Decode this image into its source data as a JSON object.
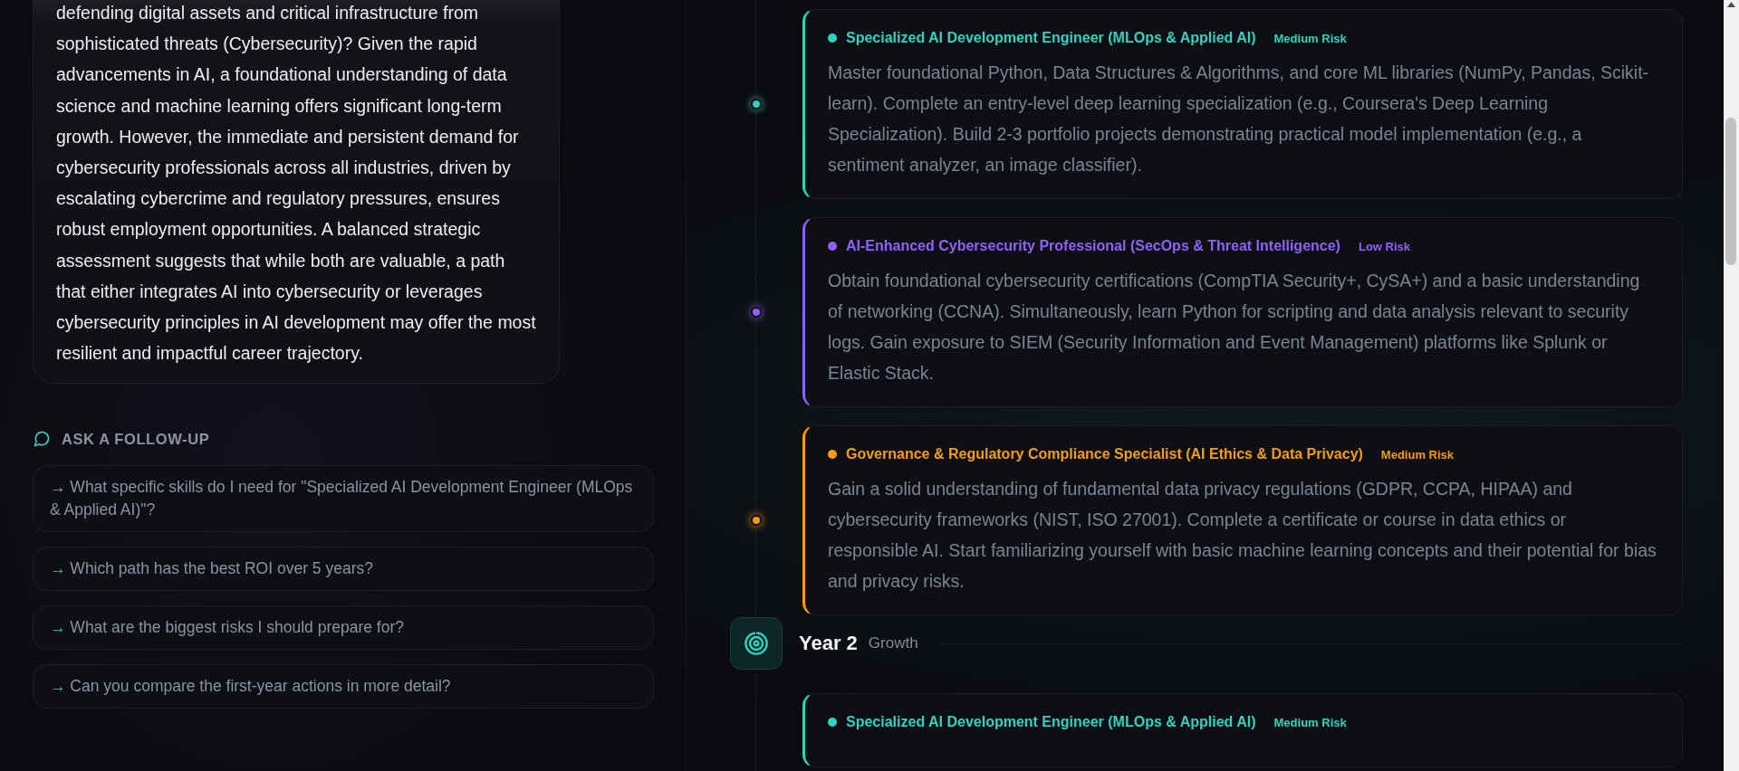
{
  "summary": {
    "text": "defending digital assets and critical infrastructure from sophisticated threats (Cybersecurity)? Given the rapid advancements in AI, a foundational understanding of data science and machine learning offers significant long-term growth. However, the immediate and persistent demand for cybersecurity professionals across all industries, driven by escalating cybercrime and regulatory pressures, ensures robust employment opportunities. A balanced strategic assessment suggests that while both are valuable, a path that either integrates AI into cybersecurity or leverages cybersecurity principles in AI development may offer the most resilient and impactful career trajectory."
  },
  "follow_up": {
    "heading": "ASK A FOLLOW-UP",
    "suggestions": [
      {
        "arrow": "→",
        "text": "What specific skills do I need for \"Specialized AI Development Engineer (MLOps & Applied AI)\"?"
      },
      {
        "arrow": "→",
        "text": "Which path has the best ROI over 5 years?"
      },
      {
        "arrow": "→",
        "text": "What are the biggest risks I should prepare for?"
      },
      {
        "arrow": "→",
        "text": "Can you compare the first-year actions in more detail?"
      }
    ]
  },
  "timeline": {
    "items": [
      {
        "kind": "path",
        "title": "Specialized AI Development Engineer (MLOps & Applied AI)",
        "risk": "Medium Risk",
        "color": "#2dd4bf",
        "description": "Master foundational Python, Data Structures & Algorithms, and core ML libraries (NumPy, Pandas, Scikit-learn). Complete an entry-level deep learning specialization (e.g., Coursera's Deep Learning Specialization). Build 2-3 portfolio projects demonstrating practical model implementation (e.g., a sentiment analyzer, an image classifier)."
      },
      {
        "kind": "path",
        "title": "AI-Enhanced Cybersecurity Professional (SecOps & Threat Intelligence)",
        "risk": "Low Risk",
        "color": "#9061f9",
        "description": "Obtain foundational cybersecurity certifications (CompTIA Security+, CySA+) and a basic understanding of networking (CCNA). Simultaneously, learn Python for scripting and data analysis relevant to security logs. Gain exposure to SIEM (Security Information and Event Management) platforms like Splunk or Elastic Stack."
      },
      {
        "kind": "path",
        "title": "Governance & Regulatory Compliance Specialist (AI Ethics & Data Privacy)",
        "risk": "Medium Risk",
        "color": "#f59e0b",
        "description": "Gain a solid understanding of fundamental data privacy regulations (GDPR, CCPA, HIPAA) and cybersecurity frameworks (NIST, ISO 27001). Complete a certificate or course in data ethics or responsible AI. Start familiarizing yourself with basic machine learning concepts and their potential for bias and privacy risks."
      },
      {
        "kind": "year",
        "label": "Year 2",
        "subtitle": "Growth"
      },
      {
        "kind": "path",
        "title": "Specialized AI Development Engineer (MLOps & Applied AI)",
        "risk": "Medium Risk",
        "color": "#2dd4bf"
      }
    ]
  }
}
